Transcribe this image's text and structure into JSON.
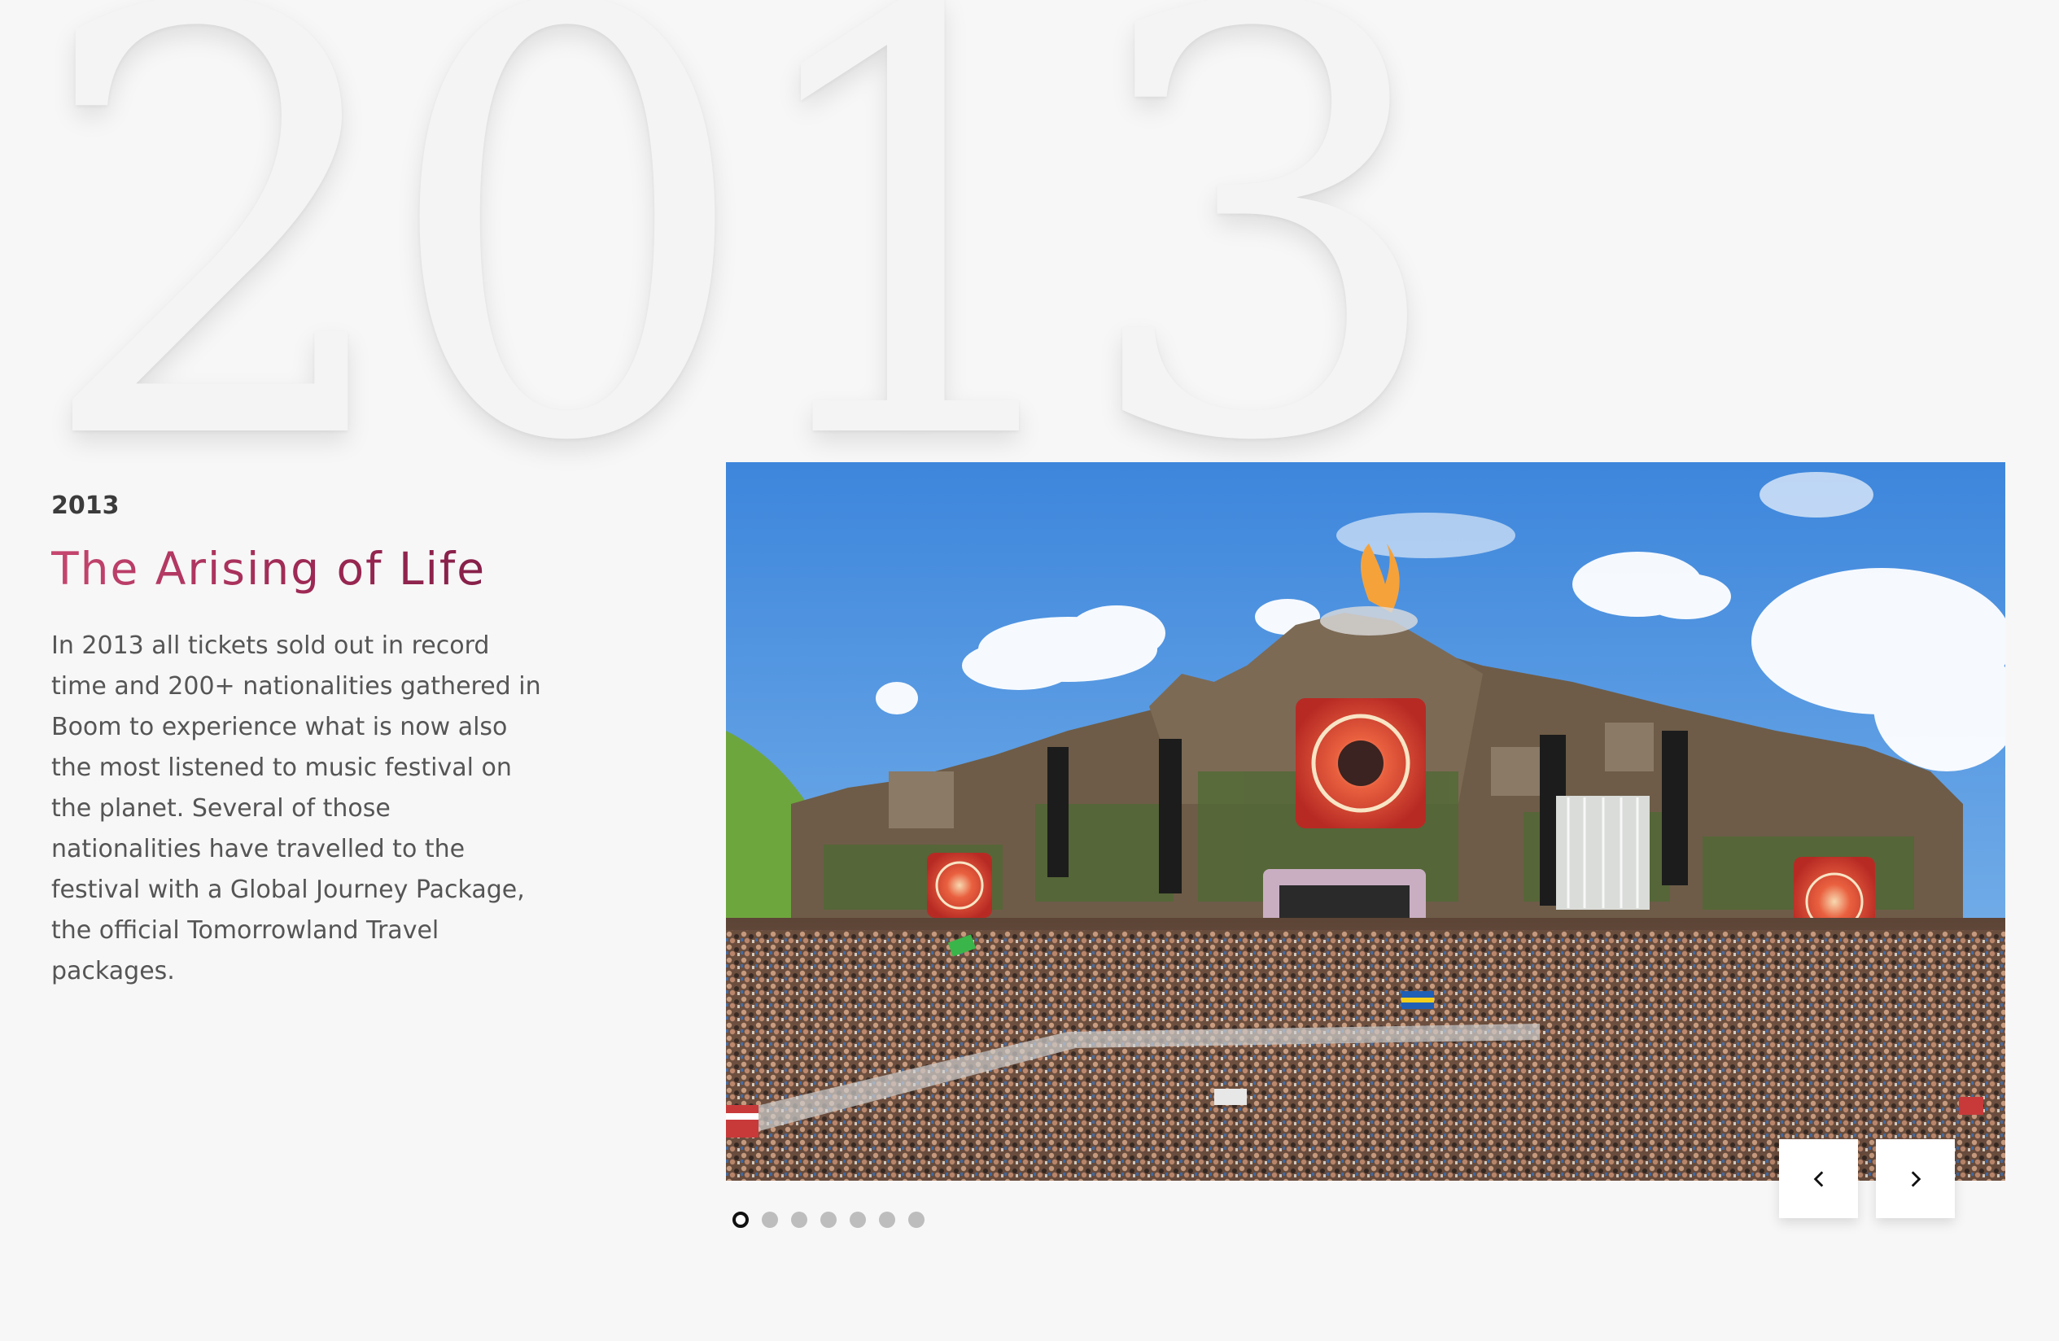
{
  "background": {
    "year_watermark": "2013"
  },
  "content": {
    "year": "2013",
    "headline": "The Arising of Life",
    "body": "In 2013 all tickets sold out in record time and 200+ nationalities gathered in Boom to experience what is now also the most listened to music festival on the planet. Several of those nationalities have travelled to the festival with a Global Journey Package, the official Tomorrowland Travel packages."
  },
  "colors": {
    "background": "#f7f7f7",
    "headline_gradient_start": "#c6466f",
    "headline_gradient_end": "#7e1d45",
    "body_text": "#555555",
    "dot_inactive": "#bdbdbd",
    "dot_active_border": "#111111"
  },
  "slider": {
    "image_subject": "festival-main-stage-crowd",
    "slide_count": 7,
    "active_index": 0,
    "prev_icon": "chevron-left-icon",
    "next_icon": "chevron-right-icon"
  }
}
